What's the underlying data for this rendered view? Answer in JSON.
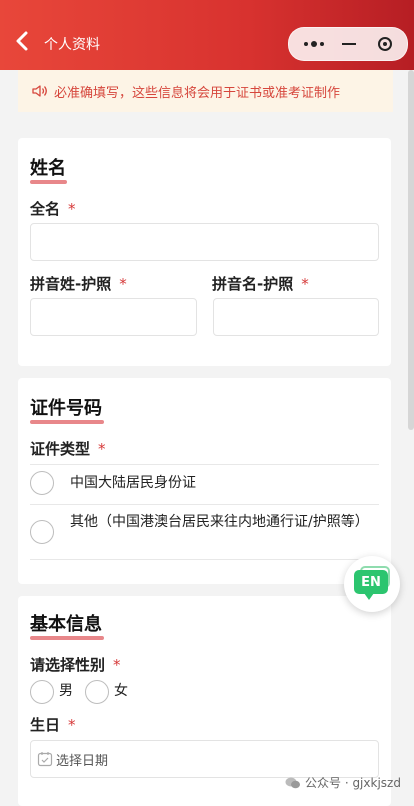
{
  "header": {
    "title": "个人资料"
  },
  "notice": {
    "text": "必准确填写，这些信息将会用于证书或准考证制作"
  },
  "name_section": {
    "title": "姓名",
    "full_name_label": "全名",
    "pinyin_surname_label": "拼音姓-护照",
    "pinyin_given_label": "拼音名-护照",
    "required_mark": "*"
  },
  "id_section": {
    "title": "证件号码",
    "type_label": "证件类型",
    "options": [
      "中国大陆居民身份证",
      "其他（中国港澳台居民来往内地通行证/护照等）"
    ],
    "required_mark": "*"
  },
  "basic_section": {
    "title": "基本信息",
    "gender_label": "请选择性别",
    "gender_options": [
      "男",
      "女"
    ],
    "birthday_label": "生日",
    "birthday_placeholder": "选择日期",
    "required_mark": "*"
  },
  "floating": {
    "lang_label": "EN"
  },
  "watermark": {
    "text": "公众号 · gjxkjszd"
  }
}
